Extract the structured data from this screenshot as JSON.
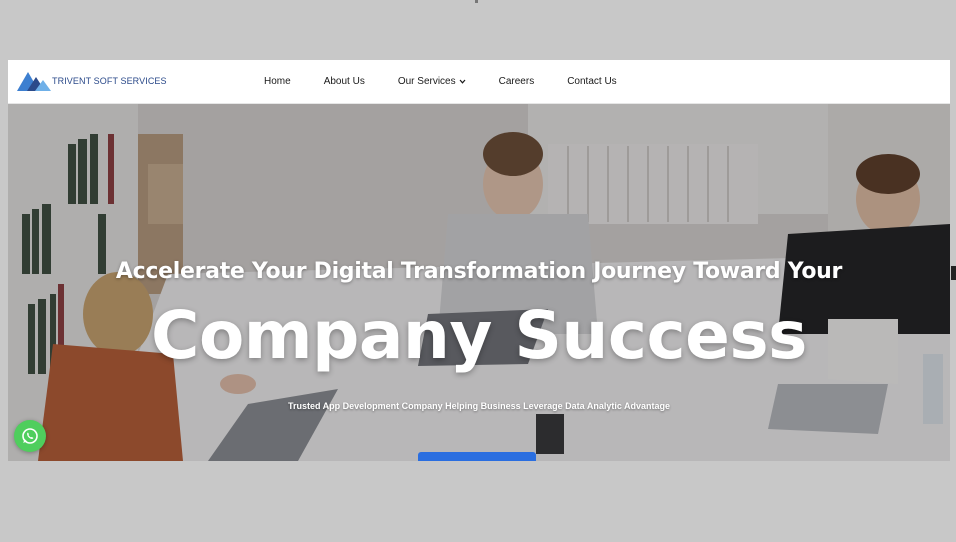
{
  "brand": {
    "name": "TRIVENT SOFT SERVICES",
    "colors": {
      "primary": "#2b4a8a",
      "accent_blue": "#2a6ee0",
      "whatsapp": "#4fce5d"
    }
  },
  "nav": {
    "items": [
      {
        "label": "Home"
      },
      {
        "label": "About Us"
      },
      {
        "label": "Our Services",
        "has_dropdown": true
      },
      {
        "label": "Careers"
      },
      {
        "label": "Contact Us"
      }
    ]
  },
  "hero": {
    "headline": "Accelerate Your Digital Transformation Journey Toward Your",
    "title": "Company Success",
    "subtitle": "Trusted App Development Company Helping Business Leverage Data Analytic Advantage"
  },
  "icons": {
    "logo": "mountain-logo-icon",
    "dropdown": "chevron-down-icon",
    "whatsapp": "whatsapp-icon"
  }
}
